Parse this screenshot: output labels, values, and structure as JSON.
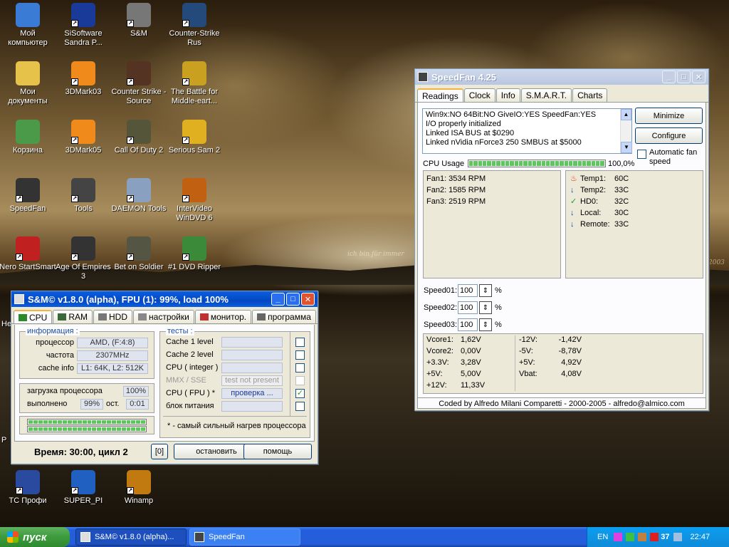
{
  "desktop": {
    "watermark": "ich bin für immer",
    "watermark2": "2003",
    "icons": [
      {
        "label": "Мой компьютер",
        "icon": "computer-icon",
        "color": "#3a7bd5"
      },
      {
        "label": "SiSoftware Sandra P...",
        "icon": "sandra-icon",
        "color": "#1a3a9a"
      },
      {
        "label": "S&M",
        "icon": "sm-icon",
        "color": "#777777"
      },
      {
        "label": "Counter-Strike Rus",
        "icon": "counter-strike-icon",
        "color": "#234a7a"
      },
      {
        "label": "Мои документы",
        "icon": "documents-icon",
        "color": "#e6c24a"
      },
      {
        "label": "3DMark03",
        "icon": "3dmark03-icon",
        "color": "#f08a1a"
      },
      {
        "label": "Counter Strike - Source",
        "icon": "cs-source-icon",
        "color": "#553322"
      },
      {
        "label": "The Battle for Middle-eart...",
        "icon": "bfme-icon",
        "color": "#c9a020"
      },
      {
        "label": "Корзина",
        "icon": "recycle-bin-icon",
        "color": "#4a9a4a"
      },
      {
        "label": "3DMark05",
        "icon": "3dmark05-icon",
        "color": "#f08a1a"
      },
      {
        "label": "Call Of Duty 2",
        "icon": "cod2-icon",
        "color": "#55553a"
      },
      {
        "label": "Serious Sam 2",
        "icon": "serious-sam-icon",
        "color": "#e0b020"
      },
      {
        "label": "SpeedFan",
        "icon": "speedfan-icon",
        "color": "#333333"
      },
      {
        "label": "Tools",
        "icon": "tools-icon",
        "color": "#444444"
      },
      {
        "label": "DAEMON Tools",
        "icon": "daemon-tools-icon",
        "color": "#8aa0c0"
      },
      {
        "label": "InterVideo WinDVD 6",
        "icon": "windvd-icon",
        "color": "#c06010"
      },
      {
        "label": "Nero StartSmart",
        "icon": "nero-icon",
        "color": "#c02020"
      },
      {
        "label": "Age Of Empires 3",
        "icon": "aoe3-icon",
        "color": "#333333"
      },
      {
        "label": "Bet on Soldier",
        "icon": "bet-on-soldier-icon",
        "color": "#555544"
      },
      {
        "label": "#1 DVD Ripper",
        "icon": "dvd-ripper-icon",
        "color": "#3a8a3a"
      },
      {
        "label": "TC Профи",
        "icon": "tc-profi-icon",
        "color": "#2a4aa0"
      },
      {
        "label": "SUPER_PI",
        "icon": "superpi-icon",
        "color": "#2060c0"
      },
      {
        "label": "Winamp",
        "icon": "winamp-icon",
        "color": "#c07a10"
      }
    ],
    "left_edge_letters": [
      "Не",
      "Р"
    ]
  },
  "sm": {
    "title": "S&M© v1.8.0 (alpha), FPU (1): 99%, load 100%",
    "tabs": [
      "CPU",
      "RAM",
      "HDD",
      "настройки",
      "монитор.",
      "программа"
    ],
    "info_group": "информация :",
    "rows": [
      {
        "label": "процессор",
        "value": "AMD,  (F:4:8)"
      },
      {
        "label": "частота",
        "value": "2307MHz"
      },
      {
        "label": "cache info",
        "value": "L1: 64K, L2: 512K"
      }
    ],
    "load_label": "загрузка  процессора",
    "load_value": "100%",
    "done_label": "выполнено",
    "done_value": "99%",
    "remain_label": "ост.",
    "remain_value": "0:01",
    "tests_group": "тесты :",
    "tests": [
      {
        "label": "Cache 1 level",
        "value": "",
        "checked": false,
        "disabled": false
      },
      {
        "label": "Cache 2 level",
        "value": "",
        "checked": false,
        "disabled": false
      },
      {
        "label": "CPU ( integer )",
        "value": "",
        "checked": false,
        "disabled": false
      },
      {
        "label": "MMX / SSE",
        "value": "test not present",
        "checked": false,
        "disabled": true
      },
      {
        "label": "CPU ( FPU ) *",
        "value": "проверка ...",
        "checked": true,
        "disabled": false
      },
      {
        "label": "блок питания",
        "value": "",
        "checked": false,
        "disabled": false
      }
    ],
    "check_mark": "✓",
    "footnote": "* - самый сильный нагрев процессора",
    "status": "Время: 30:00, цикл  2",
    "btn_zero": "[0]",
    "btn_stop": "остановить",
    "btn_help": "помощь"
  },
  "sf": {
    "title": "SpeedFan 4.25",
    "tabs": [
      "Readings",
      "Clock",
      "Info",
      "S.M.A.R.T.",
      "Charts"
    ],
    "log": [
      "Win9x:NO  64Bit:NO  GiveIO:YES  SpeedFan:YES",
      "I/O properly initialized",
      "Linked ISA BUS at $0290",
      "Linked nVidia nForce3 250 SMBUS at $5000"
    ],
    "btn_minimize": "Minimize",
    "btn_configure": "Configure",
    "auto_fan": "Automatic fan speed",
    "cpu_usage_label": "CPU Usage",
    "cpu_usage_value": "100,0%",
    "cpu_usage_fraction": 1.0,
    "fans": [
      "Fan1: 3534 RPM",
      "Fan2: 1585 RPM",
      "Fan3: 2519 RPM"
    ],
    "temps": [
      {
        "name": "Temp1:",
        "value": "60C",
        "icon": "flame-icon"
      },
      {
        "name": "Temp2:",
        "value": "33C",
        "icon": "arrow-down-icon"
      },
      {
        "name": "HD0:",
        "value": "32C",
        "icon": "checkmark-icon"
      },
      {
        "name": "Local:",
        "value": "30C",
        "icon": "arrow-down-icon"
      },
      {
        "name": "Remote:",
        "value": "33C",
        "icon": "arrow-down-icon"
      }
    ],
    "speeds": [
      {
        "label": "Speed01:",
        "value": "100"
      },
      {
        "label": "Speed02:",
        "value": "100"
      },
      {
        "label": "Speed03:",
        "value": "100"
      }
    ],
    "percent": "%",
    "volts_left": [
      {
        "name": "Vcore1:",
        "value": "1,62V"
      },
      {
        "name": "Vcore2:",
        "value": "0,00V"
      },
      {
        "name": "+3.3V:",
        "value": "3,28V"
      },
      {
        "name": "+5V:",
        "value": "5,00V"
      },
      {
        "name": "+12V:",
        "value": "11,33V"
      }
    ],
    "volts_right": [
      {
        "name": "-12V:",
        "value": "-1,42V"
      },
      {
        "name": "-5V:",
        "value": "-8,78V"
      },
      {
        "name": "+5V:",
        "value": "4,92V"
      },
      {
        "name": "Vbat:",
        "value": "4,08V"
      }
    ],
    "footer": "Coded by Alfredo Milani Comparetti - 2000-2005 - alfredo@almico.com"
  },
  "taskbar": {
    "start": "пуск",
    "tasks": [
      {
        "label": "S&M© v1.8.0 (alpha)...",
        "icon": "sm-icon",
        "active": true
      },
      {
        "label": "SpeedFan",
        "icon": "speedfan-icon",
        "active": false
      }
    ],
    "lang": "EN",
    "tray_num": "37",
    "clock": "22:47"
  }
}
